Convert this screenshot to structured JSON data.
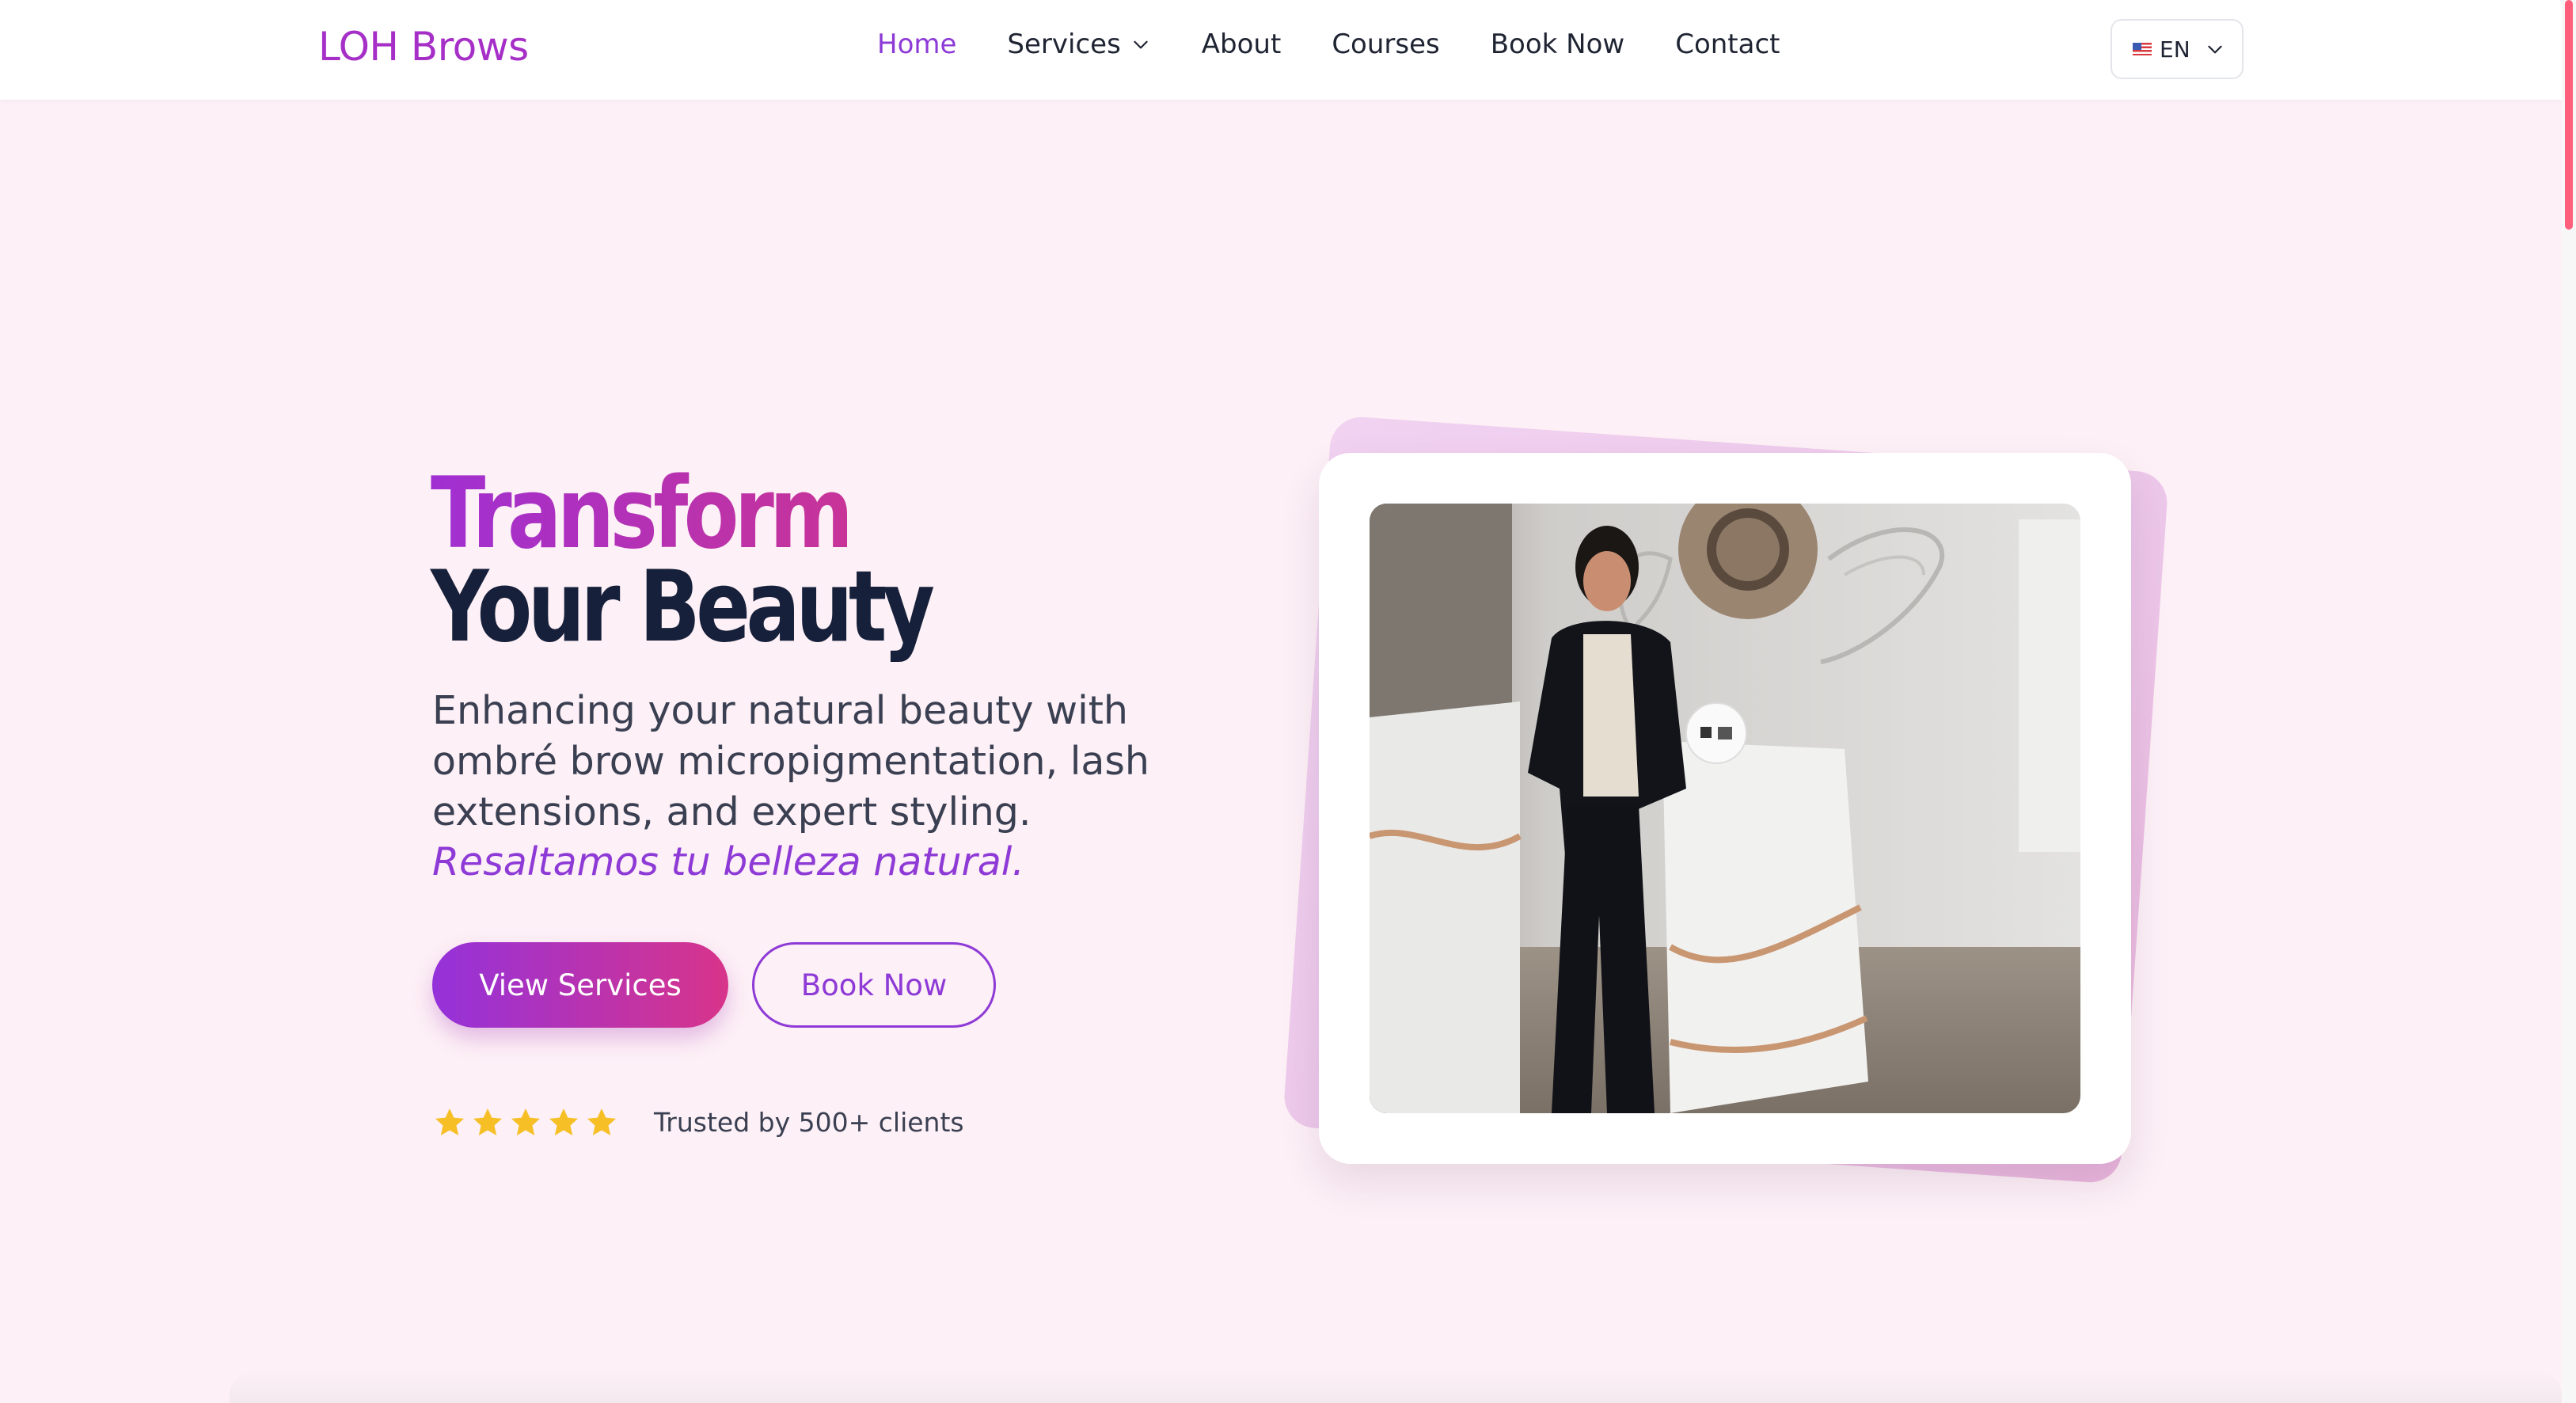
{
  "brand": {
    "name": "LOH Brows",
    "color": "#a62fc7"
  },
  "nav": {
    "items": [
      {
        "label": "Home",
        "active": true
      },
      {
        "label": "Services",
        "has_dropdown": true
      },
      {
        "label": "About"
      },
      {
        "label": "Courses"
      },
      {
        "label": "Book Now"
      },
      {
        "label": "Contact"
      }
    ],
    "active_color": "#8e3ad6"
  },
  "language": {
    "code": "EN",
    "flag_icon": "us-flag-icon"
  },
  "hero": {
    "title_line1": "Transform",
    "title_line2": "Your Beauty",
    "subtitle": "Enhancing your natural beauty with ombré brow micropigmentation, lash extensions, and expert styling.",
    "tagline": "Resaltamos tu belleza natural.",
    "primary_button": "View Services",
    "secondary_button": "Book Now",
    "rating": {
      "stars": 5,
      "max": 5,
      "icon": "star-icon",
      "color": "#f6bf26"
    },
    "trusted_text": "Trusted by 500+ clients",
    "gradient": [
      "#9432da",
      "#d8348a"
    ]
  },
  "image": {
    "icon": "salon-photo"
  }
}
